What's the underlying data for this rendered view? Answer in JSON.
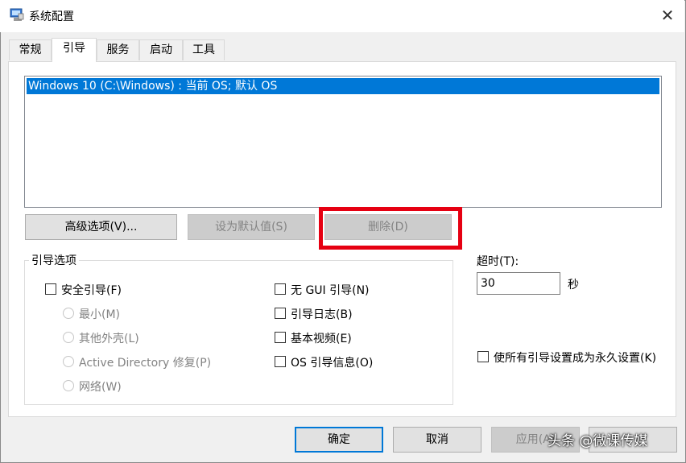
{
  "window": {
    "title": "系统配置",
    "close_glyph": "✕",
    "app_icon": "msconfig-icon"
  },
  "tabs": [
    {
      "label": "常规",
      "active": false
    },
    {
      "label": "引导",
      "active": true
    },
    {
      "label": "服务",
      "active": false
    },
    {
      "label": "启动",
      "active": false
    },
    {
      "label": "工具",
      "active": false
    }
  ],
  "boot_list": {
    "items": [
      "Windows 10 (C:\\Windows) : 当前 OS; 默认 OS"
    ],
    "selected_index": 0
  },
  "boot_buttons": {
    "advanced": "高级选项(V)...",
    "set_default": "设为默认值(S)",
    "delete": "删除(D)"
  },
  "boot_options": {
    "title": "引导选项",
    "safe_boot": "安全引导(F)",
    "minimal": "最小(M)",
    "alternate_shell": "其他外壳(L)",
    "active_directory": "Active Directory 修复(P)",
    "network": "网络(W)",
    "no_gui": "无 GUI 引导(N)",
    "boot_log": "引导日志(B)",
    "base_video": "基本视频(E)",
    "os_boot_info": "OS 引导信息(O)"
  },
  "timeout": {
    "label": "超时(T):",
    "value": "30",
    "unit": "秒"
  },
  "permanent": {
    "label": "使所有引导设置成为永久设置(K)"
  },
  "footer": {
    "ok": "确定",
    "cancel": "取消",
    "apply": "应用(A)"
  },
  "watermark": "头条 @微课传媒",
  "colors": {
    "selection": "#0078d7",
    "highlight_box": "#e60012"
  }
}
